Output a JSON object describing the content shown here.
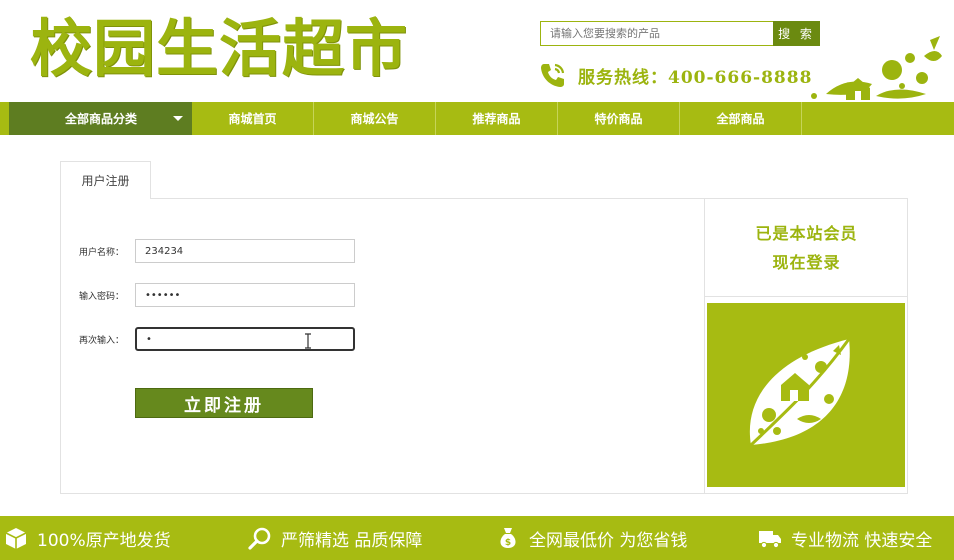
{
  "header": {
    "logo_text": "校园生活超市",
    "search": {
      "placeholder": "请输入您要搜索的产品",
      "button_label": "搜 索"
    },
    "hotline": "服务热线：400-666-8888"
  },
  "nav": {
    "all_categories_label": "全部商品分类",
    "items": [
      {
        "label": "商城首页"
      },
      {
        "label": "商城公告"
      },
      {
        "label": "推荐商品"
      },
      {
        "label": "特价商品"
      },
      {
        "label": "全部商品"
      }
    ]
  },
  "register": {
    "tab_label": "用户注册",
    "username": {
      "label": "用户名称：",
      "value": "234234"
    },
    "password": {
      "label": "输入密码：",
      "value": "••••••"
    },
    "confirm": {
      "label": "再次输入：",
      "value": "•"
    },
    "submit_label": "立即注册"
  },
  "sidebar": {
    "line1": "已是本站会员",
    "line2": "现在登录"
  },
  "footer": {
    "items": [
      {
        "label": "100%原产地发货",
        "icon": "box-icon"
      },
      {
        "label": "严筛精选  品质保障",
        "icon": "magnifier-icon"
      },
      {
        "label": "全网最低价 为您省钱",
        "icon": "money-bag-icon"
      },
      {
        "label": "专业物流  快速安全",
        "icon": "truck-icon"
      }
    ]
  },
  "colors": {
    "brand": "#a7bb12",
    "brand_dark": "#5e7d21",
    "button": "#66891d"
  }
}
